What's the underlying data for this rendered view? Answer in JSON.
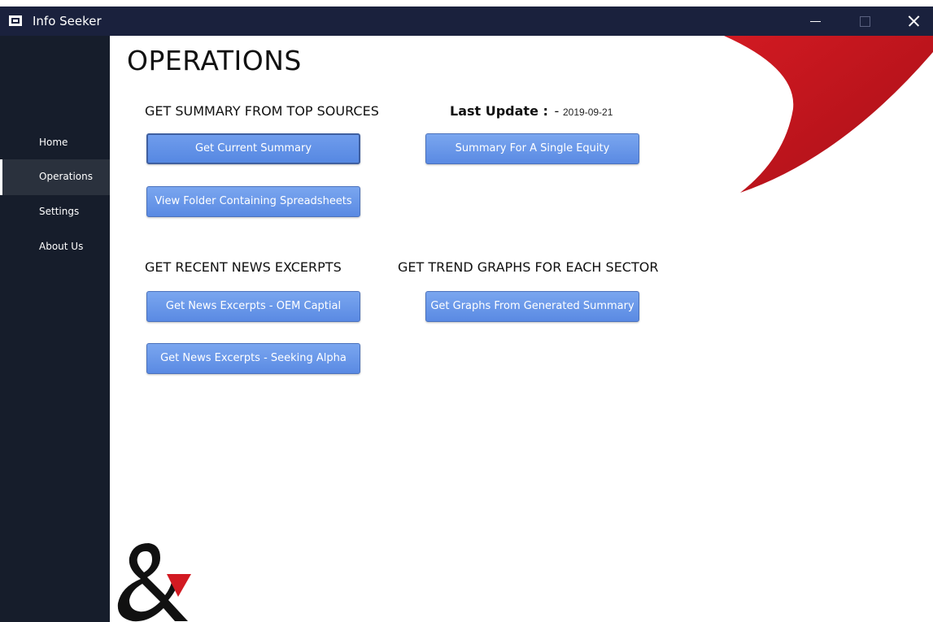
{
  "window": {
    "title": "Info Seeker"
  },
  "sidebar": {
    "items": [
      {
        "label": "Home"
      },
      {
        "label": "Operations"
      },
      {
        "label": "Settings"
      },
      {
        "label": "About Us"
      }
    ],
    "active": "Operations"
  },
  "main": {
    "title": "OPERATIONS",
    "summary_heading": "GET SUMMARY FROM TOP SOURCES",
    "last_update_label": "Last Update :",
    "last_update_dash": "-",
    "last_update_value": "2019-09-21",
    "news_heading": "GET RECENT NEWS EXCERPTS",
    "trend_heading": "GET TREND GRAPHS FOR EACH SECTOR",
    "buttons": {
      "current_summary": "Get Current Summary",
      "single_equity": "Summary For A Single Equity",
      "view_folder": "View Folder Containing Spreadsheets",
      "news_oem": "Get News Excerpts - OEM Captial",
      "news_seeking_alpha": "Get News Excerpts - Seeking Alpha",
      "graphs": "Get Graphs From Generated Summary"
    }
  },
  "colors": {
    "titlebar": "#1a213d",
    "sidebar": "#161d2b",
    "button": "#6a98ea",
    "accent_red": "#c8151d",
    "logo": "#111111"
  }
}
